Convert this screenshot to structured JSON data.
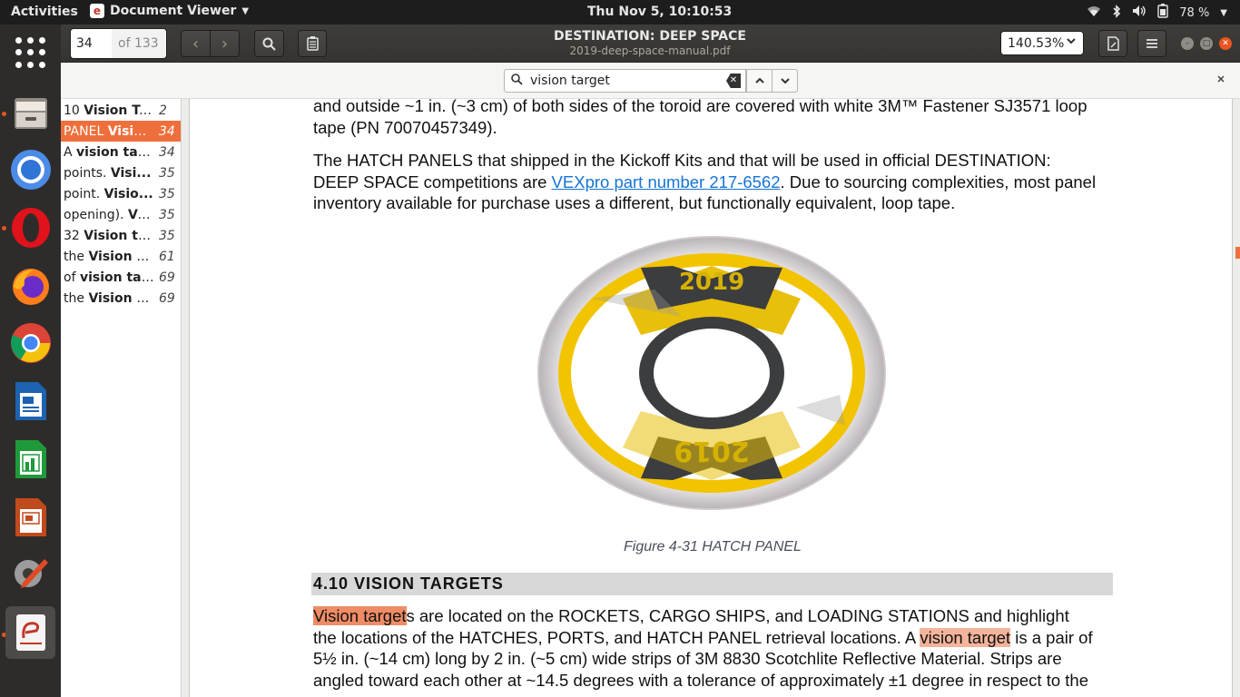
{
  "topbar": {
    "activities": "Activities",
    "app_name": "Document Viewer",
    "clock": "Thu Nov  5, 10:10:53",
    "battery": "78 %"
  },
  "window": {
    "page_current": "34",
    "page_total": "of 133",
    "title": "DESTINATION: DEEP SPACE",
    "subtitle": "2019-deep-space-manual.pdf",
    "zoom": "140.53%"
  },
  "find": {
    "query": "vision target"
  },
  "results": [
    {
      "pre": "10 ",
      "match": "Vision Ta...",
      "page": "2"
    },
    {
      "pre": "PANEL ",
      "match": "Visio...",
      "page": "34",
      "selected": true
    },
    {
      "pre": "A ",
      "match": "vision tar...",
      "page": "34"
    },
    {
      "pre": "points. ",
      "match": "Visi...",
      "page": "35"
    },
    {
      "pre": "point. ",
      "match": "Visio...",
      "page": "35"
    },
    {
      "pre": "opening). ",
      "match": "Vi...",
      "page": "35"
    },
    {
      "pre": "32 ",
      "match": "Vision ta...",
      "page": "35"
    },
    {
      "pre": "the ",
      "match": "Vision T...",
      "page": "61"
    },
    {
      "pre": "of ",
      "match": "vision ta...",
      "page": "69"
    },
    {
      "pre": "the ",
      "match": "Vision T...",
      "page": "69"
    }
  ],
  "doc": {
    "para1_line1": "and outside ~1 in. (~3 cm) of both sides of the toroid are covered with white 3M™ Fastener SJ3571 loop",
    "para1_line2": "tape (PN 70070457349).",
    "para2_line1": "The HATCH PANELS that shipped in the Kickoff Kits and that will be used in official DESTINATION:",
    "para2_line2a": "DEEP SPACE competitions are ",
    "para2_link": "VEXpro part number 217-6562",
    "para2_line2b": ". Due to sourcing complexities, most panel",
    "para2_line3": "inventory available for purchase uses a different, but functionally equivalent, loop tape.",
    "figure_year": "2019",
    "caption": "Figure 4-31 HATCH PANEL",
    "section": "4.10 VISION TARGETS",
    "para3_hl1": "Vision target",
    "para3_l1": "s are located on the ROCKETS, CARGO SHIPS, and LOADING STATIONS and highlight",
    "para3_l2a": "the locations of the HATCHES, PORTS, and HATCH PANEL retrieval locations. A ",
    "para3_hl2": "vision target",
    "para3_l2b": " is a pair of",
    "para3_l3": "5½ in. (~14 cm) long by 2 in. (~5 cm) wide strips of 3M 8830 Scotchlite Reflective Material. Strips are",
    "para3_l4": "angled toward each other at ~14.5 degrees with a tolerance of approximately ±1 degree in respect to the"
  },
  "icons": {
    "dock": [
      "app-grid-icon",
      "files-icon",
      "chromium-icon",
      "opera-icon",
      "firefox-icon",
      "chrome-icon",
      "writer-icon",
      "calc-icon",
      "impress-icon",
      "settings-icon",
      "document-viewer-icon"
    ],
    "accent": "#ef6f3c"
  }
}
